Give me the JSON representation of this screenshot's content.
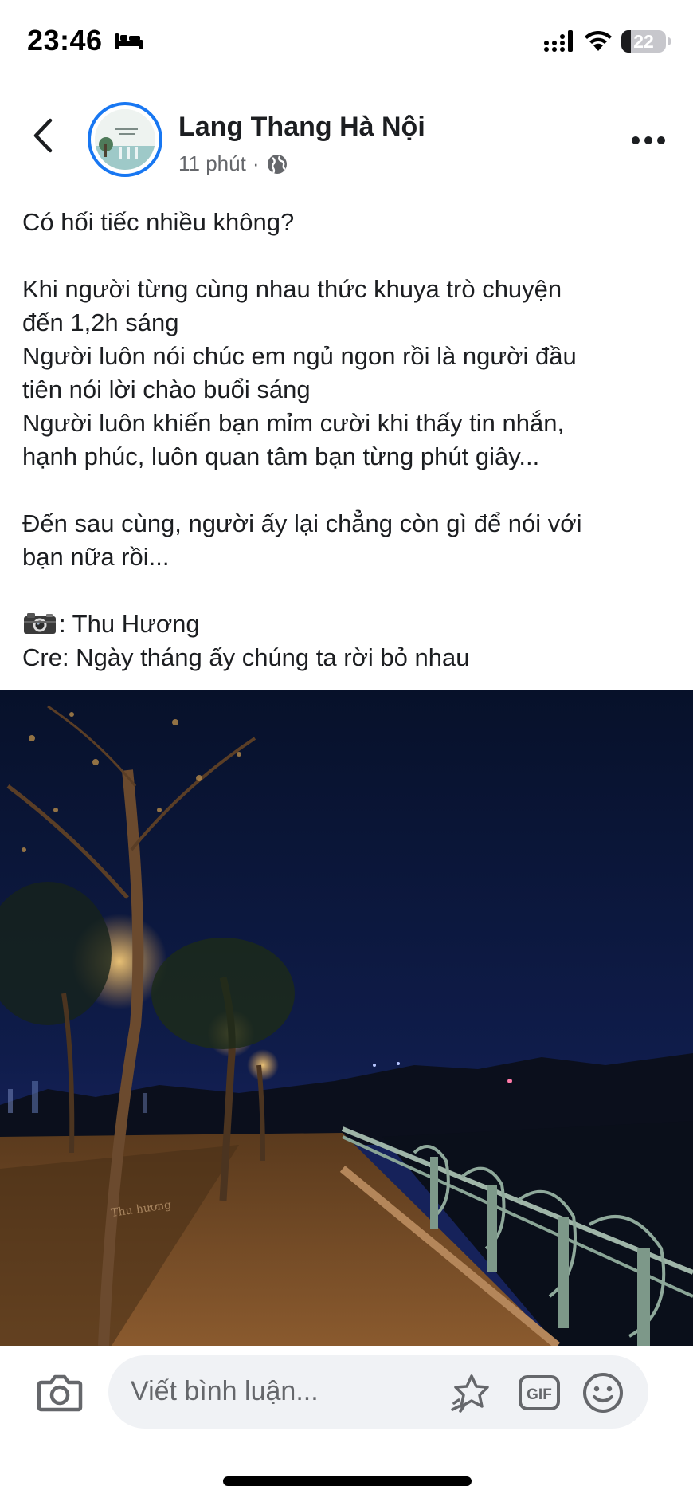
{
  "status_bar": {
    "time": "23:46",
    "focus_icon": "bed-icon",
    "signal_icon": "signal-icon",
    "wifi_icon": "wifi-icon",
    "battery_level": "22",
    "battery_fraction": 0.22
  },
  "header": {
    "back_icon": "chevron-left-icon",
    "page_name": "Lang Thang Hà Nội",
    "time_ago": "11 phút",
    "separator": "·",
    "audience_icon": "globe-icon",
    "more_icon": "more-horizontal-icon"
  },
  "post": {
    "lines": [
      "Có hối tiếc nhiều không?",
      "Khi người từng cùng nhau thức khuya trò chuyện\nđến 1,2h sáng\nNgười luôn nói chúc em ngủ ngon rồi là người đầu\ntiên nói lời chào buổi sáng\nNgười luôn khiến bạn mỉm cười khi thấy tin nhắn,\nhạnh phúc, luôn quan tâm bạn từng phút giây...",
      "Đến sau cùng, người ấy lại chẳng còn gì để nói với\nbạn nữa rồi...",
      ": Thu Hương",
      "Cre: Ngày tháng ấy chúng ta rời bỏ nhau"
    ],
    "photo_icon": "camera-emoji-icon",
    "photo_watermark": "Thu hương"
  },
  "comment_bar": {
    "camera_icon": "camera-icon",
    "placeholder": "Viết bình luận...",
    "sticker_icon": "sticker-icon",
    "gif_label": "GIF",
    "emoji_icon": "smiley-icon"
  }
}
